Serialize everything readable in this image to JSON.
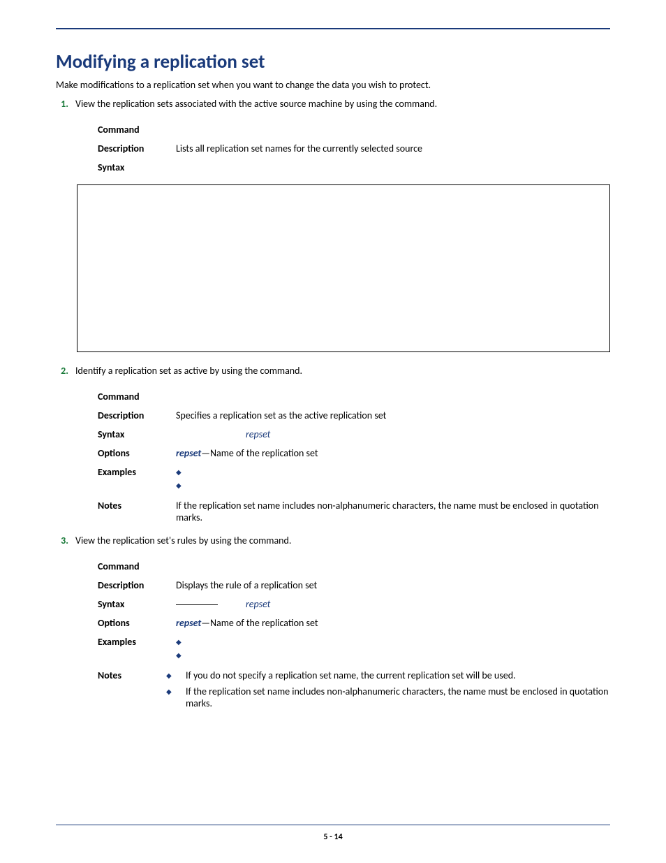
{
  "heading": "Modifying a replication set",
  "intro": "Make modifications to a replication set when you want to change the data you wish to protect.",
  "steps": {
    "s1": {
      "num": "1.",
      "pre": "View the replication sets associated with the active source machine by using the ",
      "post": " command."
    },
    "s2": {
      "num": "2.",
      "pre": "Identify a replication set as active by using the ",
      "post": " command."
    },
    "s3": {
      "num": "3.",
      "pre": "View the replication set's rules by using the ",
      "post": " command."
    }
  },
  "block1": {
    "command_label": "Command",
    "description_label": "Description",
    "description_value": "Lists all replication set names for the currently selected source",
    "syntax_label": "Syntax"
  },
  "block2": {
    "command_label": "Command",
    "description_label": "Description",
    "description_value": "Specifies a replication set as the active replication set",
    "syntax_label": "Syntax",
    "syntax_var": "repset",
    "options_label": "Options",
    "options_var": "repset",
    "options_text": "—Name of the replication set",
    "examples_label": "Examples",
    "notes_label": "Notes",
    "notes_text": "If the replication set name includes non-alphanumeric characters, the name must be enclosed in quotation marks."
  },
  "block3": {
    "command_label": "Command",
    "description_label": "Description",
    "description_value": "Displays the rule of a replication set",
    "syntax_label": "Syntax",
    "syntax_var": "repset",
    "options_label": "Options",
    "options_var": "repset",
    "options_text": "—Name of the replication set",
    "examples_label": "Examples",
    "notes_label": "Notes",
    "notes_b1": "If you do not specify a replication set name, the current replication set will be used.",
    "notes_b2": "If the replication set name includes non-alphanumeric characters, the name must be enclosed in quotation marks."
  },
  "page_number": "5 - 14"
}
